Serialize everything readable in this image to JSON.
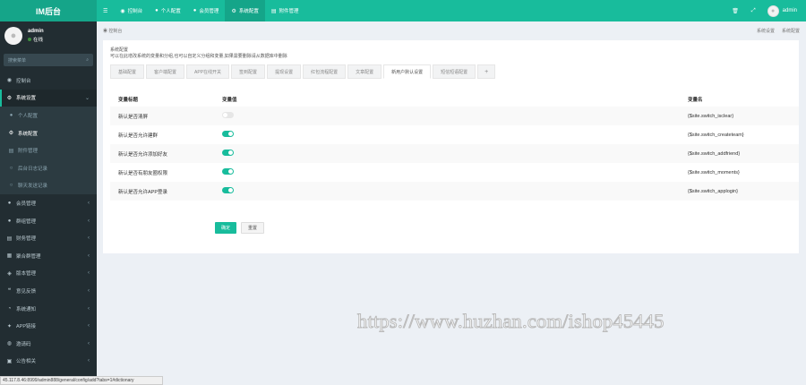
{
  "app": {
    "logo": "IM后台"
  },
  "topnav": [
    {
      "icon": "menu-icon",
      "glyph": "☰",
      "label": ""
    },
    {
      "icon": "dashboard-icon",
      "glyph": "◉",
      "label": "控制台"
    },
    {
      "icon": "user-icon",
      "glyph": "👤",
      "label": "个人配置"
    },
    {
      "icon": "users-icon",
      "glyph": "👥",
      "label": "会员管理"
    },
    {
      "icon": "gear-icon",
      "glyph": "⚙",
      "label": "系统配置"
    },
    {
      "icon": "file-icon",
      "glyph": "▤",
      "label": "附件管理"
    }
  ],
  "topright": {
    "username": "admin"
  },
  "sidebar": {
    "user": {
      "name": "admin",
      "status": "在线"
    },
    "search_placeholder": "搜索菜单",
    "items": [
      {
        "label": "控制台",
        "glyph": "◉",
        "arrow": ""
      },
      {
        "label": "系统设置",
        "glyph": "⚙",
        "arrow": "⌄",
        "open": true
      },
      {
        "label": "会员管理",
        "glyph": "👥",
        "arrow": "‹"
      },
      {
        "label": "群组管理",
        "glyph": "👥",
        "arrow": "‹"
      },
      {
        "label": "财务管理",
        "glyph": "▤",
        "arrow": "‹"
      },
      {
        "label": "聚合群管理",
        "glyph": "▦",
        "arrow": "‹"
      },
      {
        "label": "版本管理",
        "glyph": "◈",
        "arrow": "‹"
      },
      {
        "label": "意见反馈",
        "glyph": "❝",
        "arrow": "‹"
      },
      {
        "label": "系统通知",
        "glyph": "◔",
        "arrow": "‹"
      },
      {
        "label": "APP链接",
        "glyph": "✦",
        "arrow": "‹"
      },
      {
        "label": "邀请码",
        "glyph": "◍",
        "arrow": "‹"
      },
      {
        "label": "公告相关",
        "glyph": "▣",
        "arrow": "‹"
      }
    ],
    "submenu": [
      {
        "label": "个人配置",
        "glyph": "👤"
      },
      {
        "label": "系统配置",
        "glyph": "⚙",
        "active": true
      },
      {
        "label": "附件管理",
        "glyph": "▤"
      },
      {
        "label": "后台日志记录",
        "glyph": "○"
      },
      {
        "label": "聊天发送记录",
        "glyph": "○"
      }
    ]
  },
  "breadcrumb": {
    "home": "控制台",
    "right1": "系统设置",
    "right2": "系统配置"
  },
  "panel": {
    "title": "系统配置",
    "desc": "可以在此增改系统的变量和分组,也可以自定义分组和变量,如果需要删除请从数据库中删除",
    "tabs": [
      "基础配置",
      "客户端配置",
      "APP在线开关",
      "签到配置",
      "提现设置",
      "红包流程配置",
      "文章配置",
      "新用户默认设置",
      "短信短语配置"
    ],
    "active_tab": 7,
    "columns": [
      "变量标题",
      "变量值",
      "变量名"
    ],
    "rows": [
      {
        "title": "新认是否清屏",
        "value": false,
        "name": "{$site.switch_isclear}"
      },
      {
        "title": "新认是否允许建群",
        "value": true,
        "name": "{$site.switch_createteam}"
      },
      {
        "title": "新认是否允许添加好友",
        "value": true,
        "name": "{$site.switch_addfriend}"
      },
      {
        "title": "新认是否有朋友圈权限",
        "value": true,
        "name": "{$site.switch_moments}"
      },
      {
        "title": "新认是否允许APP登录",
        "value": true,
        "name": "{$site.switch_applogin}"
      }
    ],
    "submit": "确定",
    "reset": "重置"
  },
  "watermark": "https://www.huzhan.com/ishop45445",
  "status_url": "45.117.8.46:8999/admin888/general/config/add?tabs=1#dictionary",
  "colors": {
    "accent": "#18bc9c",
    "sidebar": "#222d32"
  }
}
